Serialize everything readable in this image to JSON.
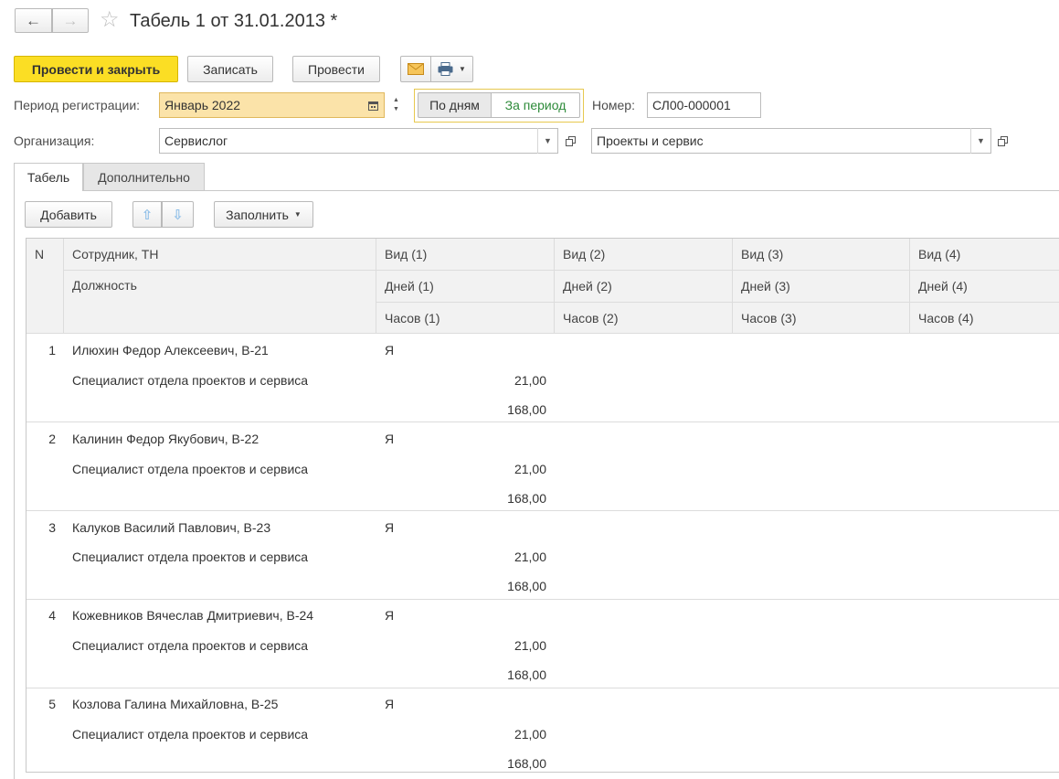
{
  "window": {
    "title": "Табель 1 от 31.01.2013 *"
  },
  "nav": {
    "back_glyph": "←",
    "forward_glyph": "→",
    "star_glyph": "☆"
  },
  "toolbar": {
    "post_close_label": "Провести и закрыть",
    "save_label": "Записать",
    "post_label": "Провести",
    "email_icon": "envelope-icon",
    "print_icon": "printer-icon"
  },
  "form": {
    "period_label": "Период регистрации:",
    "period_value": "Январь 2022",
    "mode_days_label": "По дням",
    "mode_period_label": "За период",
    "number_label": "Номер:",
    "number_value": "СЛ00-000001",
    "org_label": "Организация:",
    "org_value": "Сервислог",
    "department_value": "Проекты и сервис"
  },
  "tabs": [
    {
      "label": "Табель",
      "active": true
    },
    {
      "label": "Дополнительно",
      "active": false
    }
  ],
  "table_toolbar": {
    "add_label": "Добавить",
    "fill_label": "Заполнить"
  },
  "table": {
    "headers": {
      "n": "N",
      "employee": "Сотрудник, ТН",
      "position": "Должность",
      "kind": [
        "Вид (1)",
        "Вид (2)",
        "Вид (3)",
        "Вид (4)"
      ],
      "days": [
        "Дней (1)",
        "Дней (2)",
        "Дней (3)",
        "Дней (4)"
      ],
      "hours": [
        "Часов (1)",
        "Часов (2)",
        "Часов (3)",
        "Часов (4)"
      ]
    },
    "rows": [
      {
        "n": "1",
        "employee": "Илюхин Федор Алексеевич, В-21",
        "position": "Специалист отдела проектов и сервиса",
        "kind": "Я",
        "days": "21,00",
        "hours": "168,00"
      },
      {
        "n": "2",
        "employee": "Калинин Федор Якубович, В-22",
        "position": "Специалист отдела проектов и сервиса",
        "kind": "Я",
        "days": "21,00",
        "hours": "168,00"
      },
      {
        "n": "3",
        "employee": "Калуков Василий Павлович, В-23",
        "position": "Специалист отдела проектов и сервиса",
        "kind": "Я",
        "days": "21,00",
        "hours": "168,00"
      },
      {
        "n": "4",
        "employee": "Кожевников Вячеслав Дмитриевич, В-24",
        "position": "Специалист отдела проектов и сервиса",
        "kind": "Я",
        "days": "21,00",
        "hours": "168,00"
      },
      {
        "n": "5",
        "employee": "Козлова Галина Михайловна, В-25",
        "position": "Специалист отдела проектов и сервиса",
        "kind": "Я",
        "days": "21,00",
        "hours": "168,00"
      }
    ]
  },
  "colors": {
    "accent_yellow": "#fbde24",
    "period_field_bg": "#fbe3a9",
    "green_text": "#2e8b3a"
  }
}
